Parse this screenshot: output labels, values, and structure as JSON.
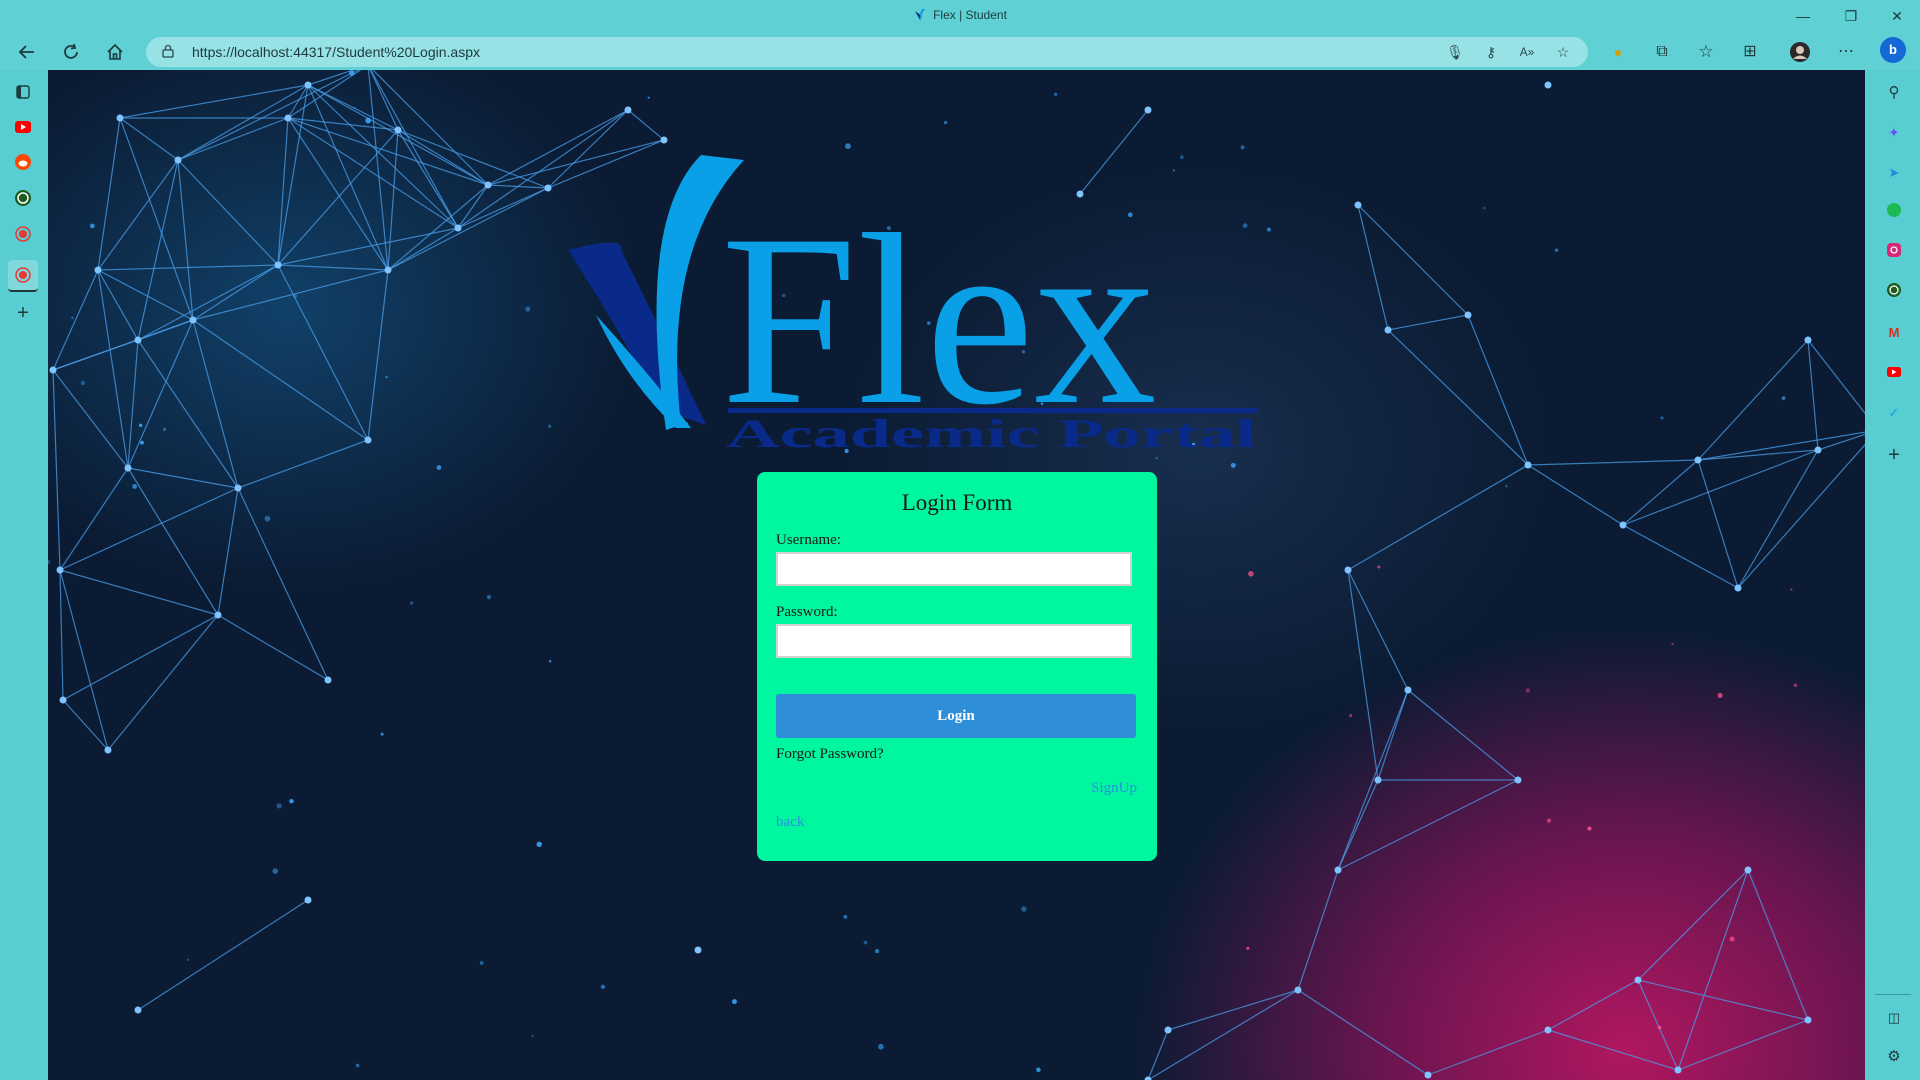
{
  "browser": {
    "window_title": "Flex | Student",
    "url": "https://localhost:44317/Student%20Login.aspx",
    "controls": {
      "minimize": "—",
      "maximize": "❐",
      "close": "✕"
    },
    "toolbar_icons": [
      "back-icon",
      "refresh-icon",
      "home-icon",
      "more-icon"
    ],
    "left_sidebar_icons": [
      "tab-actions-icon",
      "youtube-icon",
      "reddit-icon",
      "whatsapp-icon",
      "record-icon",
      "record-active-icon",
      "add-icon"
    ],
    "right_sidebar_icons": [
      "bing-icon",
      "search-icon",
      "copilot-icon",
      "telegram-icon",
      "spotify-icon",
      "instagram-icon",
      "whatsapp-icon",
      "gmail-icon",
      "youtube-icon",
      "app-icon",
      "add-icon",
      "sidebar-toggle-icon",
      "settings-icon"
    ]
  },
  "logo": {
    "brand": "Flex",
    "tagline": "Academic Portal"
  },
  "login": {
    "title": "Login Form",
    "username_label": "Username:",
    "username_value": "",
    "password_label": "Password:",
    "password_value": "",
    "login_button": "Login",
    "forgot_link": "Forgot Password?",
    "signup_link": "SignUp",
    "back_link": "back"
  },
  "colors": {
    "chrome": "#5fd0d4",
    "card_bg": "#00f7a0",
    "button_bg": "#2e8ed8",
    "link": "#2b8fe0",
    "logo_blue": "#0aa0e8"
  }
}
